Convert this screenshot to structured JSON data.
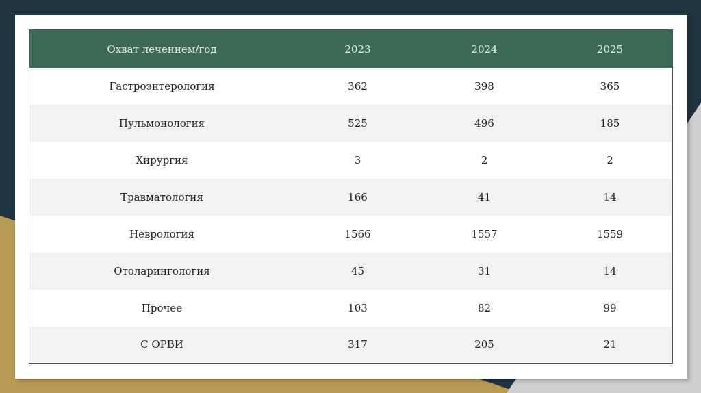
{
  "table": {
    "headers": [
      "Охват лечением/год",
      "2023",
      "2024",
      "2025"
    ],
    "rows": [
      [
        "Гастроэнтерология",
        "362",
        "398",
        "365"
      ],
      [
        "Пульмонология",
        "525",
        "496",
        "185"
      ],
      [
        "Хирургия",
        "3",
        "2",
        "2"
      ],
      [
        "Травматология",
        "166",
        "41",
        "14"
      ],
      [
        "Неврология",
        "1566",
        "1557",
        "1559"
      ],
      [
        "Отоларингология",
        "45",
        "31",
        "14"
      ],
      [
        "Прочее",
        "103",
        "82",
        "99"
      ],
      [
        "С ОРВИ",
        "317",
        "205",
        "21"
      ]
    ]
  },
  "colors": {
    "header_bg": "#3d6a56",
    "background_dark": "#1f3440",
    "accent_gold": "#b99a55"
  }
}
